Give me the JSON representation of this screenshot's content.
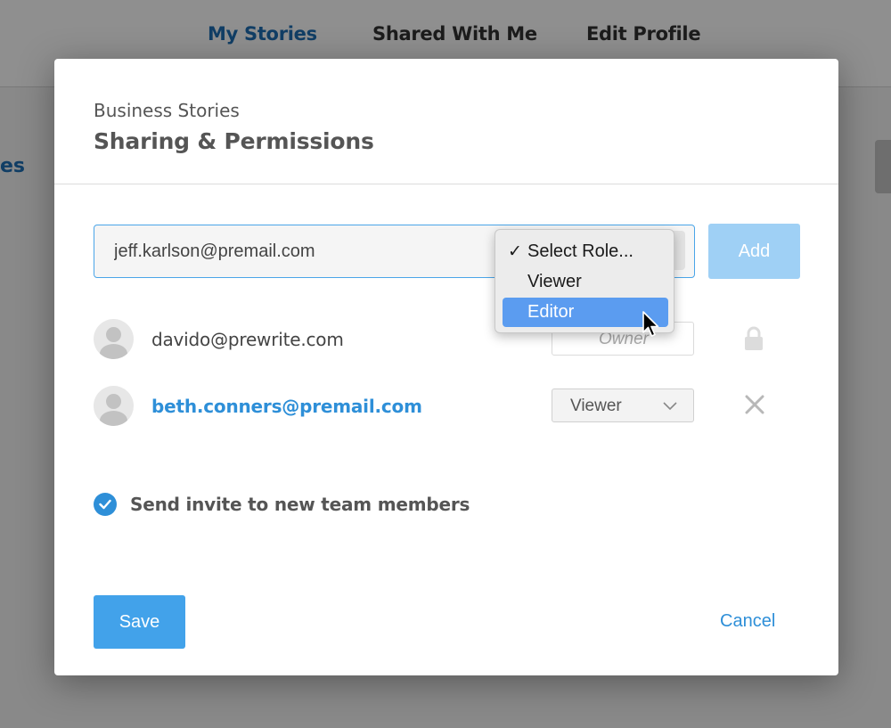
{
  "background": {
    "nav": [
      {
        "label": "My Stories",
        "active": true
      },
      {
        "label": "Shared With Me",
        "active": false
      },
      {
        "label": "Edit Profile",
        "active": false
      }
    ],
    "side_text": "es"
  },
  "modal": {
    "subtitle": "Business Stories",
    "title": "Sharing & Permissions",
    "email_input": {
      "value": "jeff.karlson@premail.com",
      "placeholder": ""
    },
    "add_label": "Add",
    "role_dropdown": {
      "selected": "Select Role...",
      "options": [
        "Select Role...",
        "Viewer",
        "Editor"
      ],
      "highlighted": "Editor",
      "check_glyph": "✓"
    },
    "members": [
      {
        "email": "davido@prewrite.com",
        "role": "Owner",
        "action_icon": "lock-icon"
      },
      {
        "email": "beth.conners@premail.com",
        "role": "Viewer",
        "action_icon": "close-icon"
      }
    ],
    "invite": {
      "label": "Send invite to new team members",
      "checked": true
    },
    "save_label": "Save",
    "cancel_label": "Cancel"
  },
  "colors": {
    "accent": "#2e8fd8",
    "save_button": "#42a2ea",
    "add_button_disabled": "#9fd0f5",
    "dropdown_highlight": "#5b9cf0"
  }
}
